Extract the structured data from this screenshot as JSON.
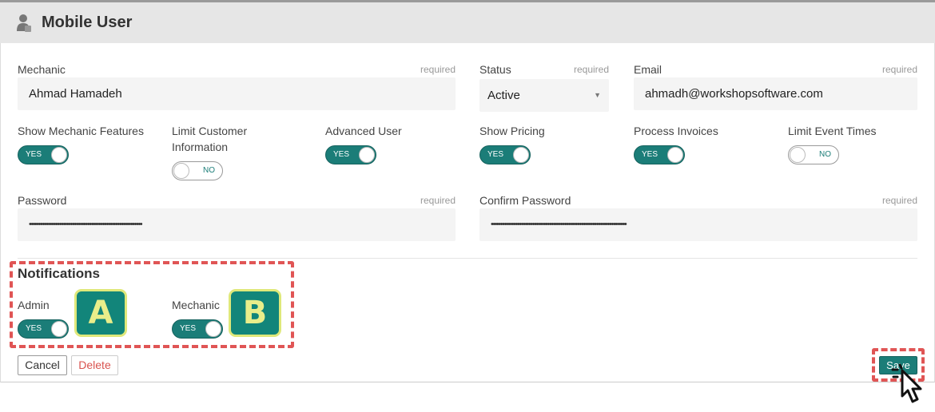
{
  "header": {
    "title": "Mobile User",
    "icon": "user-icon"
  },
  "fields": {
    "mechanic": {
      "label": "Mechanic",
      "required": "required",
      "value": "Ahmad Hamadeh"
    },
    "status": {
      "label": "Status",
      "required": "required",
      "value": "Active"
    },
    "email": {
      "label": "Email",
      "required": "required",
      "value": "ahmadh@workshopsoftware.com"
    },
    "password": {
      "label": "Password",
      "required": "required",
      "value": "••••••••••••••••••••••••••••••••••••••••••••••••••••••••••••"
    },
    "confirm_password": {
      "label": "Confirm Password",
      "required": "required",
      "value": "••••••••••••••••••••••••••••••••••••••••••••••••••••••••••••••••••••••••"
    }
  },
  "toggles": {
    "show_mechanic_features": {
      "label": "Show Mechanic Features",
      "state": "YES"
    },
    "limit_customer_information": {
      "label": "Limit Customer Information",
      "state": "NO"
    },
    "advanced_user": {
      "label": "Advanced User",
      "state": "YES"
    },
    "show_pricing": {
      "label": "Show Pricing",
      "state": "YES"
    },
    "process_invoices": {
      "label": "Process Invoices",
      "state": "YES"
    },
    "limit_event_times": {
      "label": "Limit Event Times",
      "state": "NO"
    }
  },
  "notifications": {
    "title": "Notifications",
    "admin": {
      "label": "Admin",
      "state": "YES",
      "badge": "A"
    },
    "mechanic": {
      "label": "Mechanic",
      "state": "YES",
      "badge": "B"
    }
  },
  "buttons": {
    "cancel": "Cancel",
    "delete": "Delete",
    "save": "Save"
  },
  "colors": {
    "accent": "#1b7d78",
    "highlight": "#e05555",
    "badge_fill": "#12857a",
    "badge_text": "#e9ee8a",
    "delete": "#d9534f"
  }
}
